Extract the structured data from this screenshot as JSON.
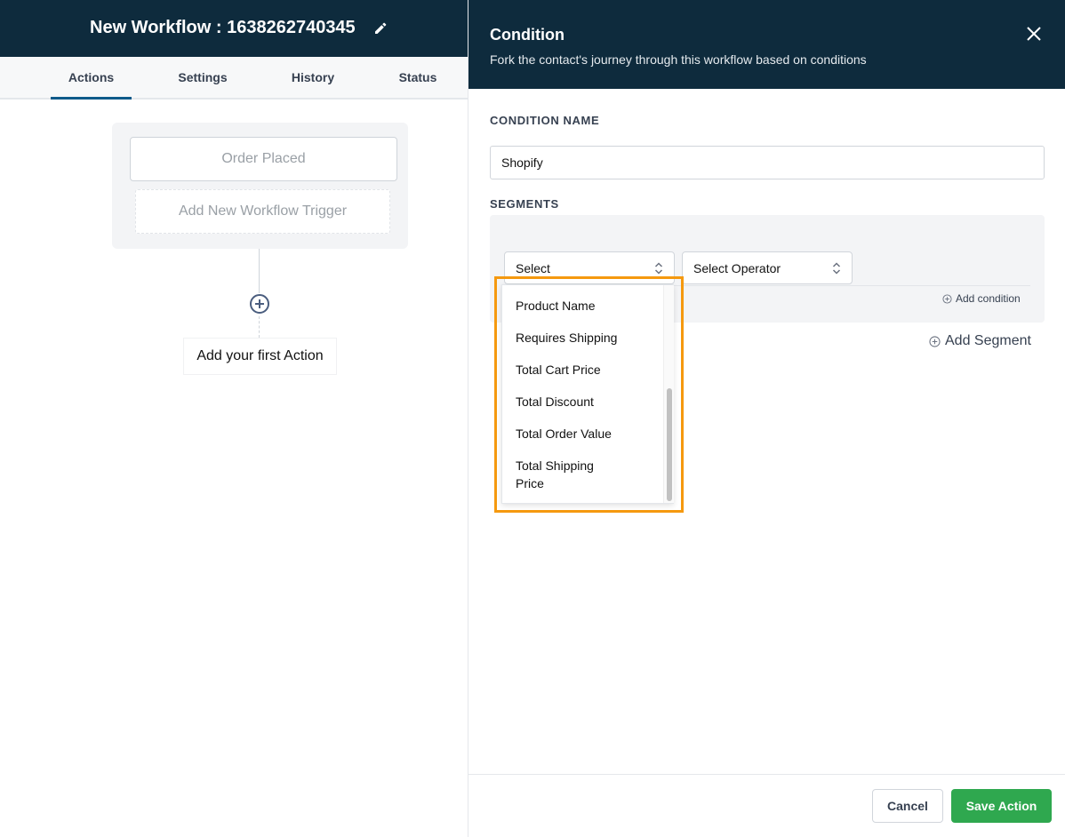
{
  "workflow": {
    "title": "New Workflow : 1638262740345",
    "tabs": [
      {
        "label": "Actions",
        "active": true
      },
      {
        "label": "Settings",
        "active": false
      },
      {
        "label": "History",
        "active": false
      },
      {
        "label": "Status",
        "active": false
      }
    ],
    "trigger_label": "Order Placed",
    "add_trigger_label": "Add New Workflow Trigger",
    "first_action_label": "Add your first Action"
  },
  "panel": {
    "title": "Condition",
    "subtitle": "Fork the contact's journey through this workflow based on conditions",
    "condition_name_label": "CONDITION NAME",
    "condition_name_value": "Shopify",
    "segments_label": "SEGMENTS",
    "field_select_value": "Select",
    "operator_select_value": "Select Operator",
    "add_condition_label": "Add condition",
    "add_segment_label": "Add Segment",
    "dropdown_options": [
      "Product Name",
      "Requires Shipping",
      "Total Cart Price",
      "Total Discount",
      "Total Order Value",
      "Total Shipping Price"
    ],
    "cancel_label": "Cancel",
    "save_label": "Save Action"
  },
  "colors": {
    "header_bg": "#0e2b3d",
    "highlight": "#f5990f",
    "save_button": "#2fa84f",
    "active_tab": "#0e5a8a"
  }
}
